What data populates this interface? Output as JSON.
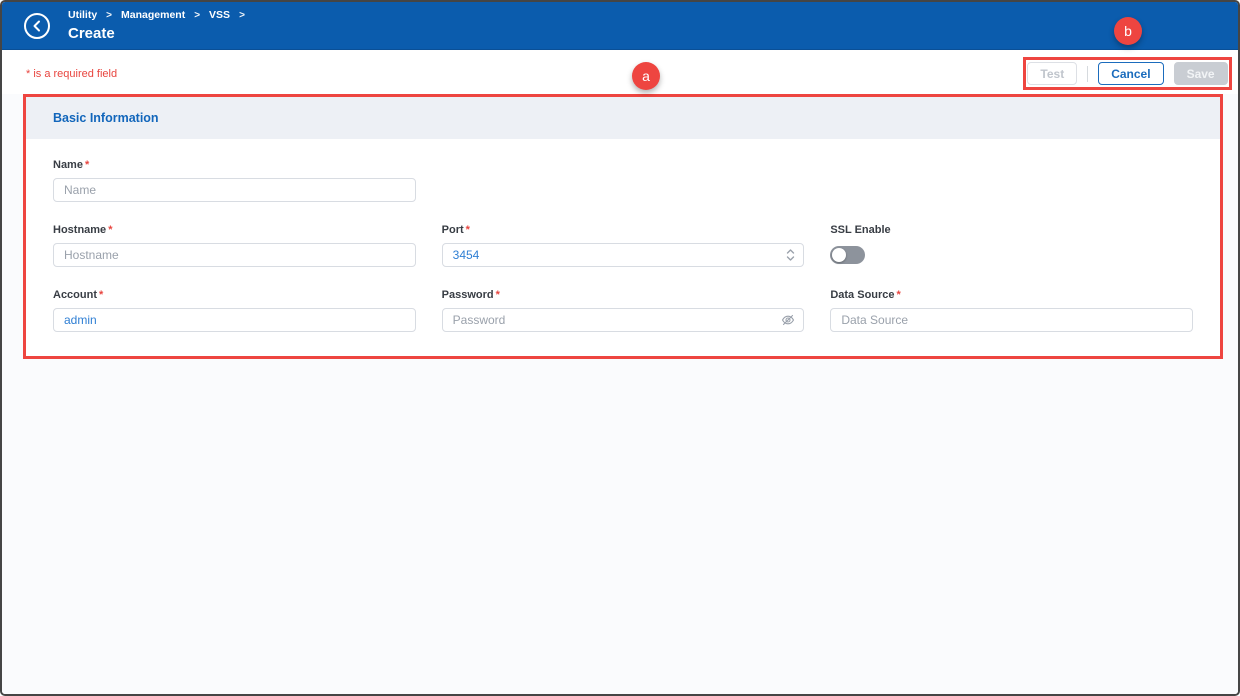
{
  "header": {
    "breadcrumb": [
      "Utility",
      "Management",
      "VSS"
    ],
    "title": "Create"
  },
  "icons": {
    "breadcrumb_separator": ">"
  },
  "toolbar": {
    "required_note": "* is a required field",
    "test_label": "Test",
    "cancel_label": "Cancel",
    "save_label": "Save"
  },
  "annotations": {
    "a": "a",
    "b": "b"
  },
  "panel": {
    "title": "Basic Information",
    "required_marker": "*",
    "fields": {
      "name": {
        "label": "Name",
        "placeholder": "Name",
        "value": ""
      },
      "hostname": {
        "label": "Hostname",
        "placeholder": "Hostname",
        "value": ""
      },
      "port": {
        "label": "Port",
        "value": "3454"
      },
      "ssl": {
        "label": "SSL Enable",
        "state": "off"
      },
      "account": {
        "label": "Account",
        "value": "admin"
      },
      "password": {
        "label": "Password",
        "placeholder": "Password",
        "value": ""
      },
      "datasource": {
        "label": "Data Source",
        "placeholder": "Data Source",
        "value": ""
      }
    }
  },
  "colors": {
    "header_blue": "#0b5cad",
    "annotation_red": "#ee4540",
    "panel_title_blue": "#1266bb",
    "value_blue": "#2f7fd4",
    "cancel_blue": "#1b6cbd"
  }
}
